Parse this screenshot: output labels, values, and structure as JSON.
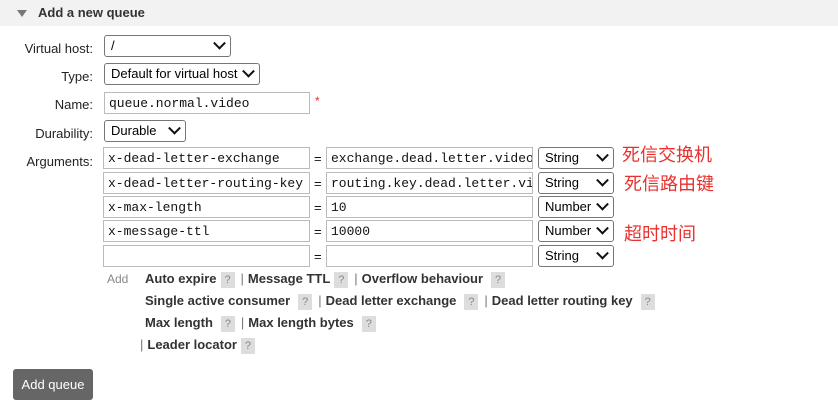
{
  "section": {
    "title": "Add a new queue"
  },
  "labels": {
    "virtual_host": "Virtual host:",
    "type": "Type:",
    "name": "Name:",
    "durability": "Durability:",
    "arguments": "Arguments:"
  },
  "fields": {
    "virtual_host": "/",
    "type": "Default for virtual host",
    "name": "queue.normal.video",
    "name_required_marker": "*",
    "durability": "Durable"
  },
  "arguments": [
    {
      "key": "x-dead-letter-exchange",
      "value": "exchange.dead.letter.video",
      "type": "String"
    },
    {
      "key": "x-dead-letter-routing-key",
      "value": "routing.key.dead.letter.video",
      "type": "String"
    },
    {
      "key": "x-max-length",
      "value": "10",
      "type": "Number"
    },
    {
      "key": "x-message-ttl",
      "value": "10000",
      "type": "Number"
    },
    {
      "key": "",
      "value": "",
      "type": "String"
    }
  ],
  "equals": "=",
  "annotations": [
    "死信交换机",
    "死信路由键",
    "超时时间"
  ],
  "add_label": "Add",
  "help_mark": "?",
  "separator": "|",
  "shortcuts": {
    "auto_expire": "Auto expire",
    "message_ttl": "Message TTL",
    "overflow_behaviour": "Overflow behaviour",
    "single_active_consumer": "Single active consumer",
    "dead_letter_exchange": "Dead letter exchange",
    "dead_letter_routing_key": "Dead letter routing key",
    "max_length": "Max length",
    "max_length_bytes": "Max length bytes",
    "leader_locator": "Leader locator"
  },
  "submit_label": "Add queue"
}
